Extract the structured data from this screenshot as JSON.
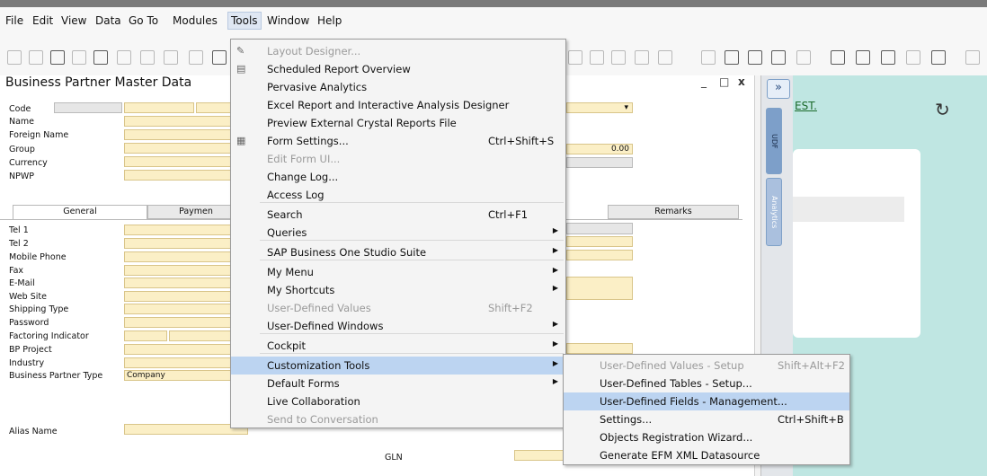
{
  "menubar": [
    "File",
    "Edit",
    "View",
    "Data",
    "Go To",
    "Modules",
    "Tools",
    "Window",
    "Help"
  ],
  "form": {
    "title": "Business Partner Master Data",
    "window_controls": [
      "_",
      "□",
      "x"
    ],
    "header_labels": [
      "Code",
      "Name",
      "Foreign Name",
      "Group",
      "Currency",
      "NPWP"
    ],
    "balance_value": "0.00",
    "tabs": [
      "General",
      "Paymen",
      "Remarks"
    ],
    "general_labels": [
      "Tel 1",
      "Tel 2",
      "Mobile Phone",
      "Fax",
      "E-Mail",
      "Web Site",
      "Shipping Type",
      "Password",
      "Factoring Indicator",
      "BP Project",
      "Industry",
      "Business Partner Type"
    ],
    "bp_type_value": "Company",
    "alias_label": "Alias Name",
    "gln_label": "GLN"
  },
  "sidebar": {
    "expand": "»",
    "tabs": [
      "UDF",
      "Analytics"
    ]
  },
  "dashboard": {
    "link_text": "EST.",
    "refresh_icon": "↻"
  },
  "tools_menu": [
    {
      "label": "Layout Designer...",
      "disabled": true,
      "shortcut": "",
      "arrow": false
    },
    {
      "label": "Scheduled Report Overview",
      "disabled": false,
      "shortcut": "",
      "arrow": false
    },
    {
      "label": "Pervasive Analytics",
      "disabled": false,
      "shortcut": "",
      "arrow": false
    },
    {
      "label": "Excel Report and Interactive Analysis Designer",
      "disabled": false,
      "shortcut": "",
      "arrow": false
    },
    {
      "label": "Preview External Crystal Reports File",
      "disabled": false,
      "shortcut": "",
      "arrow": false
    },
    {
      "label": "Form Settings...",
      "disabled": false,
      "shortcut": "Ctrl+Shift+S",
      "arrow": false
    },
    {
      "label": "Edit Form UI...",
      "disabled": true,
      "shortcut": "",
      "arrow": false
    },
    {
      "label": "Change Log...",
      "disabled": false,
      "shortcut": "",
      "arrow": false
    },
    {
      "label": "Access Log",
      "disabled": false,
      "shortcut": "",
      "arrow": false
    },
    {
      "label": "Search",
      "disabled": false,
      "shortcut": "Ctrl+F1",
      "arrow": false
    },
    {
      "label": "Queries",
      "disabled": false,
      "shortcut": "",
      "arrow": true
    },
    {
      "label": "SAP Business One Studio Suite",
      "disabled": false,
      "shortcut": "",
      "arrow": true
    },
    {
      "label": "My Menu",
      "disabled": false,
      "shortcut": "",
      "arrow": true
    },
    {
      "label": "My Shortcuts",
      "disabled": false,
      "shortcut": "",
      "arrow": true
    },
    {
      "label": "User-Defined Values",
      "disabled": true,
      "shortcut": "Shift+F2",
      "arrow": false
    },
    {
      "label": "User-Defined Windows",
      "disabled": false,
      "shortcut": "",
      "arrow": true
    },
    {
      "label": "Cockpit",
      "disabled": false,
      "shortcut": "",
      "arrow": true
    },
    {
      "label": "Customization Tools",
      "disabled": false,
      "shortcut": "",
      "arrow": true,
      "highlighted": true
    },
    {
      "label": "Default Forms",
      "disabled": false,
      "shortcut": "",
      "arrow": true
    },
    {
      "label": "Live Collaboration",
      "disabled": false,
      "shortcut": "",
      "arrow": false
    },
    {
      "label": "Send to Conversation",
      "disabled": true,
      "shortcut": "",
      "arrow": false
    }
  ],
  "customization_submenu": [
    {
      "label": "User-Defined Values - Setup",
      "disabled": true,
      "shortcut": "Shift+Alt+F2"
    },
    {
      "label": "User-Defined Tables - Setup...",
      "disabled": false,
      "shortcut": ""
    },
    {
      "label": "User-Defined Fields - Management...",
      "disabled": false,
      "shortcut": "",
      "highlighted": true
    },
    {
      "label": "Settings...",
      "disabled": false,
      "shortcut": "Ctrl+Shift+B"
    },
    {
      "label": "Objects Registration Wizard...",
      "disabled": false,
      "shortcut": ""
    },
    {
      "label": "Generate EFM XML Datasource",
      "disabled": false,
      "shortcut": ""
    }
  ]
}
